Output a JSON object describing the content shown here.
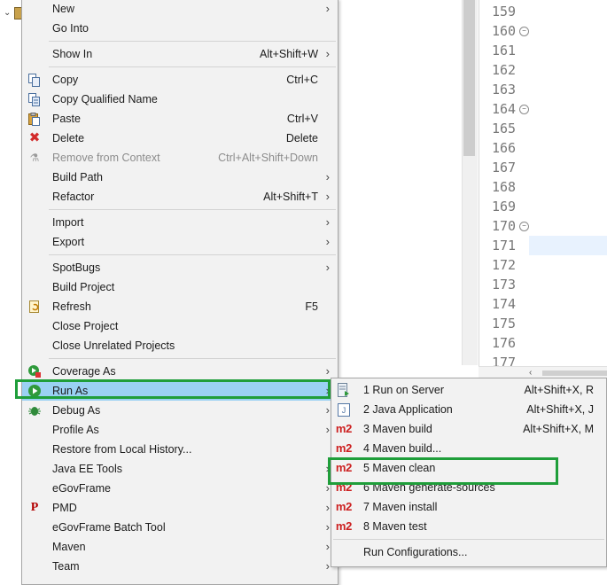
{
  "line_numbers": [
    "159",
    "160",
    "161",
    "162",
    "163",
    "164",
    "165",
    "166",
    "167",
    "168",
    "169",
    "170",
    "171",
    "172",
    "173",
    "174",
    "175",
    "176",
    "177"
  ],
  "folded_lines": [
    "160",
    "164",
    "170"
  ],
  "current_line": "171",
  "context_menu": {
    "items": [
      {
        "label": "New",
        "arrow": "›"
      },
      {
        "label": "Go Into"
      },
      {
        "sep": true
      },
      {
        "label": "Show In",
        "shortcut": "Alt+Shift+W",
        "arrow": "›"
      },
      {
        "sep": true
      },
      {
        "label": "Copy",
        "shortcut": "Ctrl+C",
        "icon": "copy-icon"
      },
      {
        "label": "Copy Qualified Name",
        "icon": "copy-qualified-name-icon"
      },
      {
        "label": "Paste",
        "shortcut": "Ctrl+V",
        "icon": "paste-icon"
      },
      {
        "label": "Delete",
        "shortcut": "Delete",
        "icon": "delete-icon"
      },
      {
        "label": "Remove from Context",
        "shortcut": "Ctrl+Alt+Shift+Down",
        "icon": "remove-context-icon",
        "disabled": true
      },
      {
        "label": "Build Path",
        "arrow": "›"
      },
      {
        "label": "Refactor",
        "shortcut": "Alt+Shift+T",
        "arrow": "›"
      },
      {
        "sep": true
      },
      {
        "label": "Import",
        "arrow": "›"
      },
      {
        "label": "Export",
        "arrow": "›"
      },
      {
        "sep": true
      },
      {
        "label": "SpotBugs",
        "arrow": "›"
      },
      {
        "label": "Build Project"
      },
      {
        "label": "Refresh",
        "shortcut": "F5",
        "icon": "refresh-icon"
      },
      {
        "label": "Close Project"
      },
      {
        "label": "Close Unrelated Projects"
      },
      {
        "sep": true
      },
      {
        "label": "Coverage As",
        "icon": "coverage-icon",
        "arrow": "›"
      },
      {
        "label": "Run As",
        "icon": "run-icon",
        "arrow": "›",
        "selected": true
      },
      {
        "label": "Debug As",
        "icon": "debug-icon",
        "arrow": "›"
      },
      {
        "label": "Profile As",
        "arrow": "›"
      },
      {
        "label": "Restore from Local History..."
      },
      {
        "label": "Java EE Tools",
        "arrow": "›"
      },
      {
        "label": "eGovFrame",
        "arrow": "›"
      },
      {
        "label": "PMD",
        "icon": "pmd-icon",
        "arrow": "›"
      },
      {
        "label": "eGovFrame Batch Tool",
        "arrow": "›"
      },
      {
        "label": "Maven",
        "arrow": "›"
      },
      {
        "label": "Team",
        "arrow": "›"
      }
    ]
  },
  "run_as_menu": {
    "items": [
      {
        "label": "1 Run on Server",
        "shortcut": "Alt+Shift+X, R",
        "icon": "run-on-server-icon"
      },
      {
        "label": "2 Java Application",
        "shortcut": "Alt+Shift+X, J",
        "icon": "java-application-icon"
      },
      {
        "label": "3 Maven build",
        "shortcut": "Alt+Shift+X, M",
        "icon": "maven-icon",
        "icon_text": "m2"
      },
      {
        "label": "4 Maven build...",
        "icon": "maven-icon",
        "icon_text": "m2"
      },
      {
        "label": "5 Maven clean",
        "icon": "maven-icon",
        "icon_text": "m2",
        "highlighted": true
      },
      {
        "label": "6 Maven generate-sources",
        "icon": "maven-icon",
        "icon_text": "m2"
      },
      {
        "label": "7 Maven install",
        "icon": "maven-icon",
        "icon_text": "m2"
      },
      {
        "label": "8 Maven test",
        "icon": "maven-icon",
        "icon_text": "m2"
      },
      {
        "sep": true
      },
      {
        "label": "Run Configurations..."
      }
    ]
  },
  "colors": {
    "menu_bg": "#f2f2f2",
    "selection": "#9ad1f3",
    "annotation_box": "#1f9e3a",
    "current_line_bg": "#e8f2fe",
    "maven_icon": "#cc1f1f"
  }
}
